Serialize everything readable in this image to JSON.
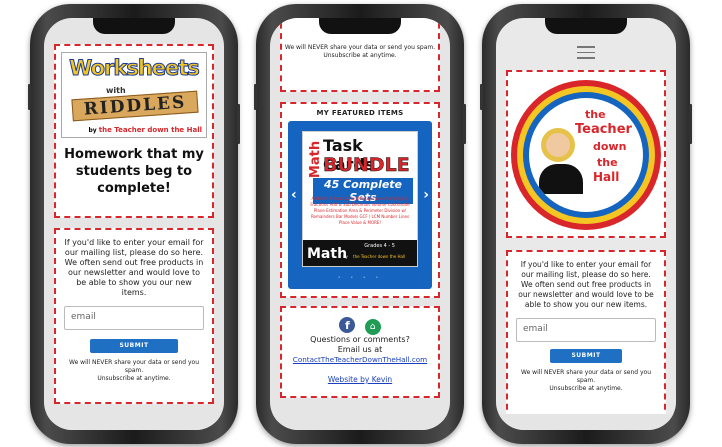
{
  "phone1": {
    "logo": {
      "word1": "Worksheets",
      "word2": "with",
      "word3": "RIDDLES",
      "by": "by",
      "brand": "the Teacher down the Hall"
    },
    "headline": "Homework that my students beg to complete!",
    "signup": {
      "text": "If you'd like to enter your email for our mailing list, please do so here. We often send out free products in our newsletter and would love to be able to show you our new items.",
      "placeholder": "email",
      "submit": "SUBMIT",
      "note1": "We will NEVER share your data or send you spam.",
      "note2": "Unsubscribe at anytime."
    }
  },
  "phone2": {
    "top_note1": "We will NEVER share your data or send you spam.",
    "top_note2": "Unsubscribe at anytime.",
    "featured_title": "MY FEATURED ITEMS",
    "product": {
      "math_side": "Math",
      "line1": "Task Cards",
      "line2": "BUNDLE",
      "line3": "45 Complete Sets",
      "topics": "Addition & Subtraction  Multiplication  Simplifying Fractions  Add & Sub Decimals  Volume  Coordinate Plane  Estimation  Area & Perimeter  Division w/ Remainders  Bar Models  GCF / LCM  Number Lines  Place Value  & MORE!",
      "bottom_math": "Math",
      "grades": "Grades 4 - 5",
      "by": "by",
      "brand": "the Teacher down the Hall",
      "prev": "‹",
      "next": "›"
    },
    "contact": {
      "question": "Questions or comments?",
      "email_label": "Email us at",
      "email": "ContactTheTeacherDownTheHall.com",
      "credit": "Website by Kevin"
    }
  },
  "phone3": {
    "menu_icon": "hamburger-menu-icon",
    "logo_words": [
      "the",
      "Teacher",
      "down",
      "the",
      "Hall"
    ],
    "signup": {
      "text": "If you'd like to enter your email for our mailing list, please do so here. We often send out free products in our newsletter and would love to be able to show you our new items.",
      "placeholder": "email",
      "submit": "SUBMIT",
      "note1": "We will NEVER share your data or send you spam.",
      "note2": "Unsubscribe at anytime."
    }
  },
  "colors": {
    "accent_red": "#d9262b",
    "submit_blue": "#1f6fc2",
    "carousel_blue": "#1565c0",
    "link_blue": "#1a3fbf"
  }
}
